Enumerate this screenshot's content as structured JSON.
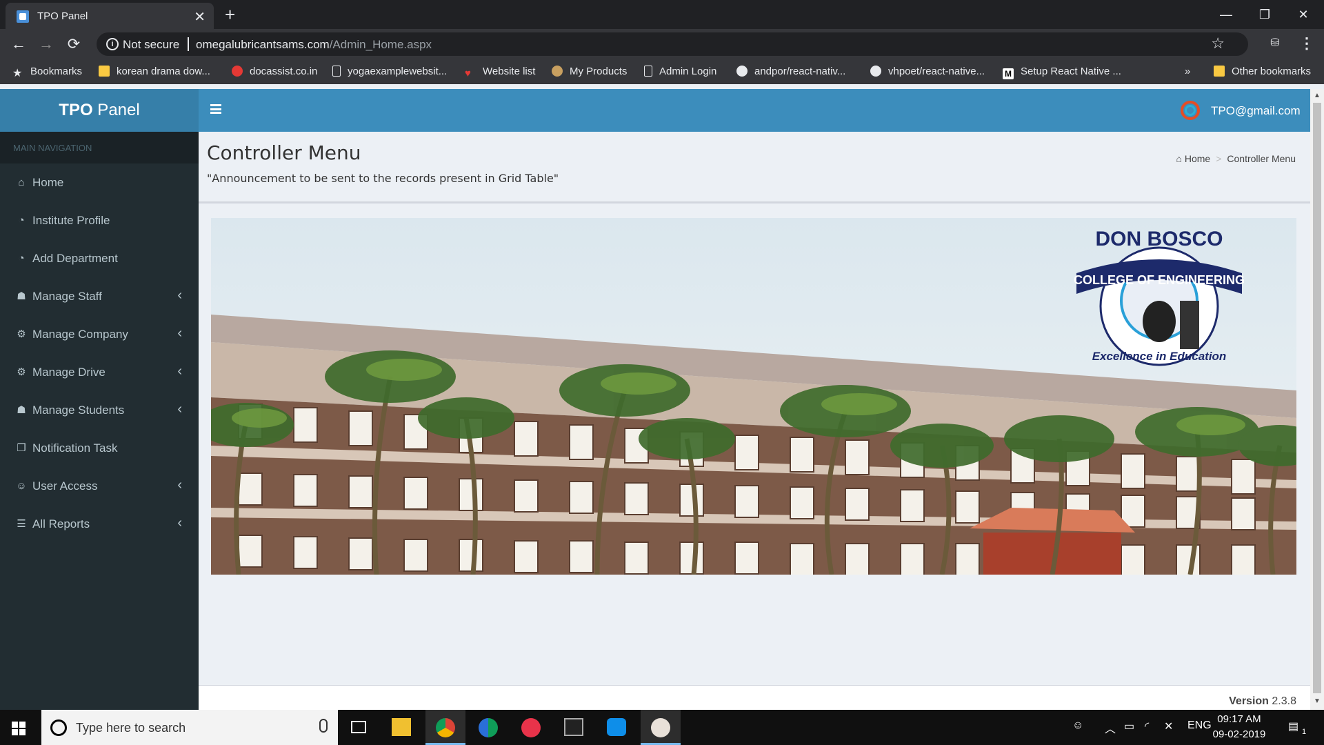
{
  "browser": {
    "tab_title": "TPO Panel",
    "tab_close": "✕",
    "new_tab": "+",
    "window_controls": {
      "minimize": "—",
      "restore": "❐",
      "close": "✕"
    },
    "nav": {
      "back": "←",
      "forward": "→",
      "reload": "⟳"
    },
    "security_label": "Not secure",
    "url_host": "omegalubricantsams.com",
    "url_path": "/Admin_Home.aspx",
    "bookmarks": [
      {
        "label": "Bookmarks",
        "icon": "star-icon"
      },
      {
        "label": "korean drama dow...",
        "icon": "folder-icon"
      },
      {
        "label": "docassist.co.in",
        "icon": "red-a-icon"
      },
      {
        "label": "yogaexamplewebsit...",
        "icon": "page-icon"
      },
      {
        "label": "Website list",
        "icon": "heart-icon"
      },
      {
        "label": "My Products",
        "icon": "bulb-icon"
      },
      {
        "label": "Admin Login",
        "icon": "page-icon"
      },
      {
        "label": "andpor/react-nativ...",
        "icon": "github-icon"
      },
      {
        "label": "vhpoet/react-native...",
        "icon": "github-icon"
      },
      {
        "label": "Setup React Native ...",
        "icon": "medium-icon"
      }
    ],
    "overflow": "»",
    "other_bookmarks": "Other bookmarks"
  },
  "app": {
    "logo_bold": "TPO",
    "logo_rest": " Panel",
    "user_email": "TPO@gmail.com"
  },
  "sidebar": {
    "header": "MAIN NAVIGATION",
    "items": [
      {
        "label": "Home",
        "icon": "home-icon",
        "glyph": "⌂",
        "has_children": false
      },
      {
        "label": "Institute Profile",
        "icon": "dashboard-icon",
        "glyph": "◔",
        "has_children": false
      },
      {
        "label": "Add Department",
        "icon": "dashboard-icon",
        "glyph": "◔",
        "has_children": false
      },
      {
        "label": "Manage Staff",
        "icon": "users-icon",
        "glyph": "☗",
        "has_children": true
      },
      {
        "label": "Manage Company",
        "icon": "cogs-icon",
        "glyph": "⚙",
        "has_children": true
      },
      {
        "label": "Manage Drive",
        "icon": "cogs-icon",
        "glyph": "⚙",
        "has_children": true
      },
      {
        "label": "Manage Students",
        "icon": "users-icon",
        "glyph": "☗",
        "has_children": true
      },
      {
        "label": "Notification Task",
        "icon": "copy-icon",
        "glyph": "❐",
        "has_children": false
      },
      {
        "label": "User Access",
        "icon": "user-plus-icon",
        "glyph": "☺",
        "has_children": true
      },
      {
        "label": "All Reports",
        "icon": "list-icon",
        "glyph": "☰",
        "has_children": true
      }
    ],
    "chevron": "‹"
  },
  "content": {
    "title": "Controller Menu",
    "description": "\"Announcement to be sent to the records present in Grid Table\"",
    "breadcrumb": {
      "home": "Home",
      "separator": ">",
      "current": "Controller Menu"
    },
    "banner_logo": {
      "top_text": "DON BOSCO",
      "ribbon_text": "COLLEGE OF ENGINEERING",
      "motto": "Excellence in Education"
    },
    "footer": {
      "version_label": "Version",
      "version_number": "2.3.8"
    }
  },
  "taskbar": {
    "search_placeholder": "Type here to search",
    "language": "ENG",
    "time": "09:17 AM",
    "date": "09-02-2019",
    "notification_count": "1"
  },
  "colors": {
    "header_blue": "#3c8dbc",
    "logo_blue": "#367fa9",
    "sidebar_dark": "#222d32",
    "sidebar_text": "#b8c7ce",
    "content_bg": "#ecf0f5"
  }
}
